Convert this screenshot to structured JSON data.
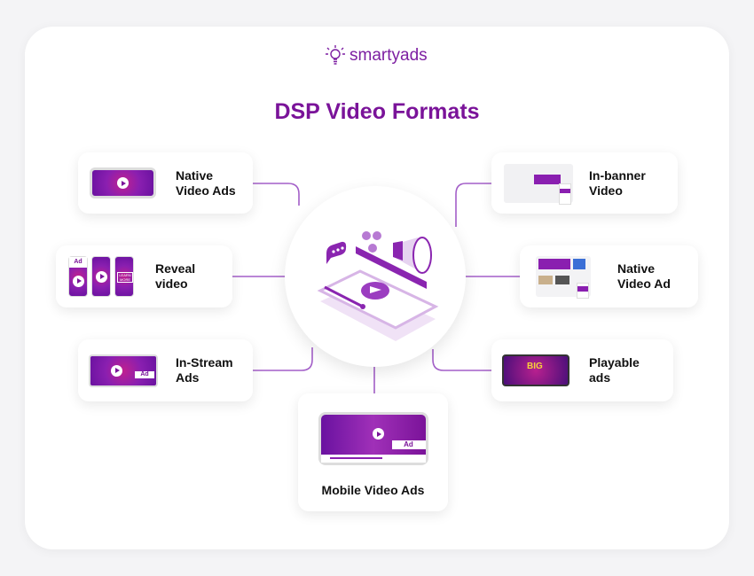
{
  "logo": {
    "text": "smartyads",
    "icon": "lightbulb-icon"
  },
  "title": "DSP Video Formats",
  "colors": {
    "accent": "#7a1399",
    "line": "#a35fc8"
  },
  "formats": [
    {
      "label": "Native\nVideo Ads"
    },
    {
      "label": "Reveal\nvideo",
      "ad_tag": "Ad",
      "cta": "LEARN MORE"
    },
    {
      "label": "In-Stream\nAds",
      "ad_tag": "Ad"
    },
    {
      "label": "In-banner\nVideo"
    },
    {
      "label": "Native\nVideo Ad"
    },
    {
      "label": "Playable\nads",
      "badge": "BIG"
    },
    {
      "label": "Mobile Video Ads",
      "ad_tag": "Ad"
    }
  ]
}
